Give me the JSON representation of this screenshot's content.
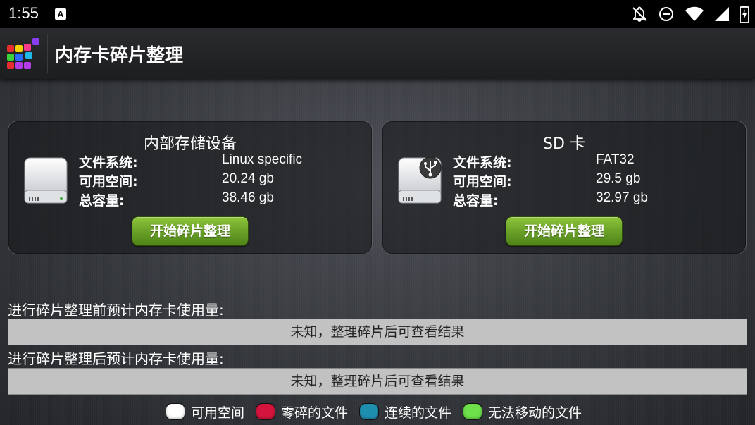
{
  "status_bar": {
    "time": "1:55",
    "notification_icon_letter": "A",
    "icons": [
      "notifications-off-icon",
      "do-not-disturb-icon",
      "wifi-icon",
      "cell-signal-icon",
      "battery-charging-icon"
    ]
  },
  "app_bar": {
    "title": "内存卡碎片整理",
    "logo_colors": [
      "#e62e2e",
      "#3ad13a",
      "#2a6bff",
      "#f5d200",
      "#b23ce6",
      "#1fb8e6",
      "#ff3b8d",
      "#8a3cf0"
    ]
  },
  "panels": {
    "internal": {
      "title": "内部存储设备",
      "rows": [
        {
          "label": "文件系统:",
          "value": "Linux specific"
        },
        {
          "label": "可用空间:",
          "value": "20.24 gb"
        },
        {
          "label": "总容量:",
          "value": "38.46 gb"
        }
      ],
      "button": "开始碎片整理"
    },
    "sd": {
      "title": "SD 卡",
      "rows": [
        {
          "label": "文件系统:",
          "value": "FAT32"
        },
        {
          "label": "可用空间:",
          "value": "29.5 gb"
        },
        {
          "label": "总容量:",
          "value": "32.97 gb"
        }
      ],
      "button": "开始碎片整理"
    }
  },
  "usage": {
    "before": {
      "label": "进行碎片整理前预计内存卡使用量:",
      "bar_text": "未知，整理碎片后可查看结果"
    },
    "after": {
      "label": "进行碎片整理后预计内存卡使用量:",
      "bar_text": "未知，整理碎片后可查看结果"
    }
  },
  "legend": [
    {
      "label": "可用空间",
      "color": "#ffffff"
    },
    {
      "label": "零碎的文件",
      "color": "#d4143c"
    },
    {
      "label": "连续的文件",
      "color": "#1f8fb0"
    },
    {
      "label": "无法移动的文件",
      "color": "#6de04a"
    }
  ]
}
